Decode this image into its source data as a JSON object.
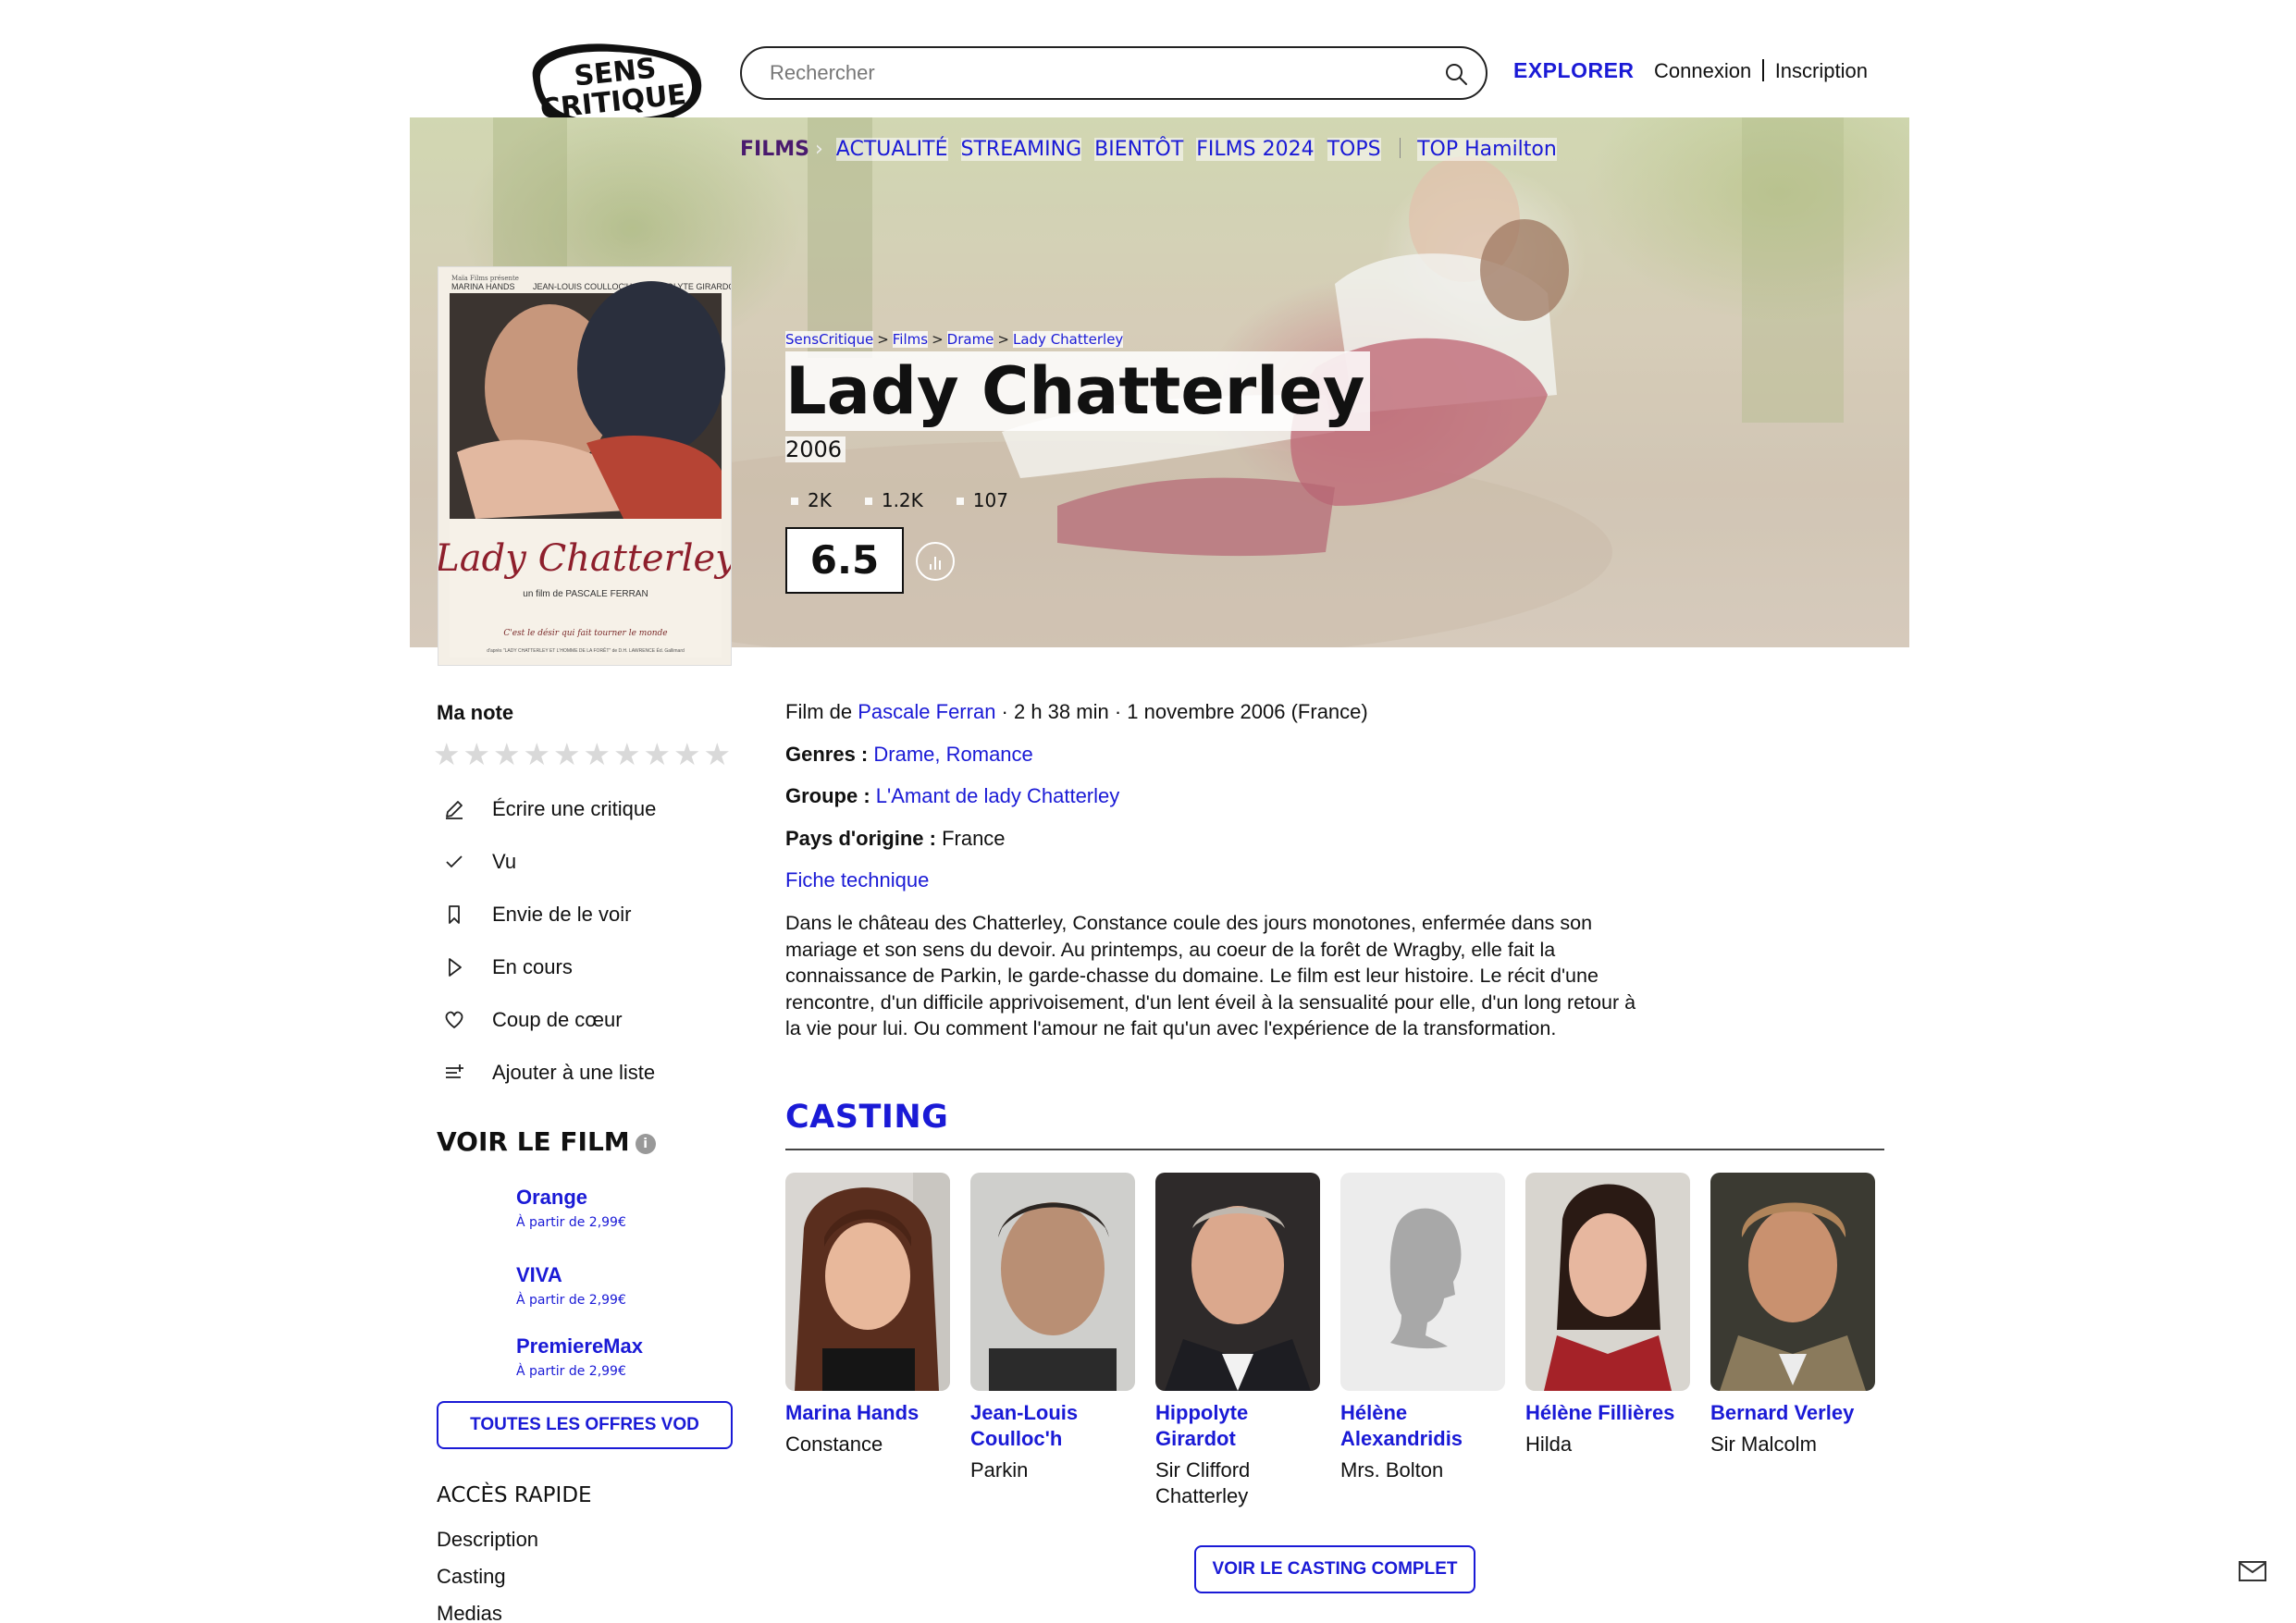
{
  "header": {
    "logo_line1": "SENS",
    "logo_line2": "CRITIQUE",
    "search_placeholder": "Rechercher",
    "explorer": "EXPLORER",
    "login": "Connexion",
    "signup": "Inscription"
  },
  "nav": {
    "films": "FILMS",
    "items": [
      "ACTUALITÉ",
      "STREAMING",
      "BIENTÔT",
      "FILMS 2024",
      "TOPS"
    ],
    "top": "TOP Hamilton"
  },
  "poster": {
    "studio": "Maïa Films présente",
    "actors": [
      "MARINA HANDS",
      "JEAN-LOUIS COULLOC'H",
      "HIPPOLYTE GIRARDOT"
    ],
    "title": "Lady Chatterley",
    "director": "un film de PASCALE FERRAN",
    "tagline": "C'est le désir qui fait tourner le monde",
    "credit": "d'après \"LADY CHATTERLEY ET L'HOMME DE LA FORÊT\" de D.H. LAWRENCE Éd. Gallimard"
  },
  "breadcrumb": [
    "SensCritique",
    "Films",
    "Drame",
    "Lady Chatterley"
  ],
  "film": {
    "title": "Lady Chatterley",
    "year": "2006",
    "stats": [
      "2K",
      "1.2K",
      "107"
    ],
    "score": "6.5"
  },
  "my_rating": {
    "label": "Ma note",
    "max_stars": 10,
    "value": 0
  },
  "actions": [
    {
      "label": "Écrire une critique",
      "icon": "pencil-icon"
    },
    {
      "label": "Vu",
      "icon": "check-icon"
    },
    {
      "label": "Envie de le voir",
      "icon": "bookmark-icon"
    },
    {
      "label": "En cours",
      "icon": "play-icon"
    },
    {
      "label": "Coup de cœur",
      "icon": "heart-icon"
    },
    {
      "label": "Ajouter à une liste",
      "icon": "list-add-icon"
    }
  ],
  "watch": {
    "title": "VOIR LE FILM",
    "info_icon": "i",
    "offers": [
      {
        "name": "Orange",
        "price": "À partir de 2,99€"
      },
      {
        "name": "VIVA",
        "price": "À partir de 2,99€"
      },
      {
        "name": "PremiereMax",
        "price": "À partir de 2,99€"
      }
    ],
    "all_offers": "TOUTES LES OFFRES VOD"
  },
  "quick_access": {
    "title": "ACCÈS RAPIDE",
    "links": [
      "Description",
      "Casting",
      "Medias"
    ]
  },
  "details": {
    "film_by_prefix": "Film de",
    "director": "Pascale Ferran",
    "meta": " · 2 h 38 min · 1 novembre 2006 (France)",
    "genres_label": "Genres :",
    "genres": "Drame, Romance",
    "group_label": "Groupe :",
    "group": "L'Amant de lady Chatterley",
    "country_label": "Pays d'origine :",
    "country": "France",
    "tech_sheet": "Fiche technique"
  },
  "synopsis": "Dans le château des Chatterley, Constance coule des jours monotones, enfermée dans son mariage et son sens du devoir. Au printemps, au coeur de la forêt de Wragby, elle fait la connaissance de Parkin, le garde-chasse du domaine. Le film est leur histoire. Le récit d'une rencontre, d'un difficile apprivoisement, d'un lent éveil à la sensualité pour elle, d'un long retour à la vie pour lui. Ou comment l'amour ne fait qu'un avec l'expérience de la transformation.",
  "casting": {
    "title": "CASTING",
    "actors": [
      {
        "name": "Marina Hands",
        "role": "Constance"
      },
      {
        "name": "Jean-Louis Coulloc'h",
        "role": "Parkin"
      },
      {
        "name": "Hippolyte Girardot",
        "role": "Sir Clifford Chatterley"
      },
      {
        "name": "Hélène Alexandridis",
        "role": "Mrs. Bolton"
      },
      {
        "name": "Hélène Fillières",
        "role": "Hilda"
      },
      {
        "name": "Bernard Verley",
        "role": "Sir Malcolm"
      }
    ],
    "see_all": "VOIR LE CASTING COMPLET"
  },
  "colors": {
    "accent": "#1a1ad6",
    "nav_films": "#4a1a6e",
    "text": "#111111",
    "star_empty": "#d9d9d9"
  }
}
